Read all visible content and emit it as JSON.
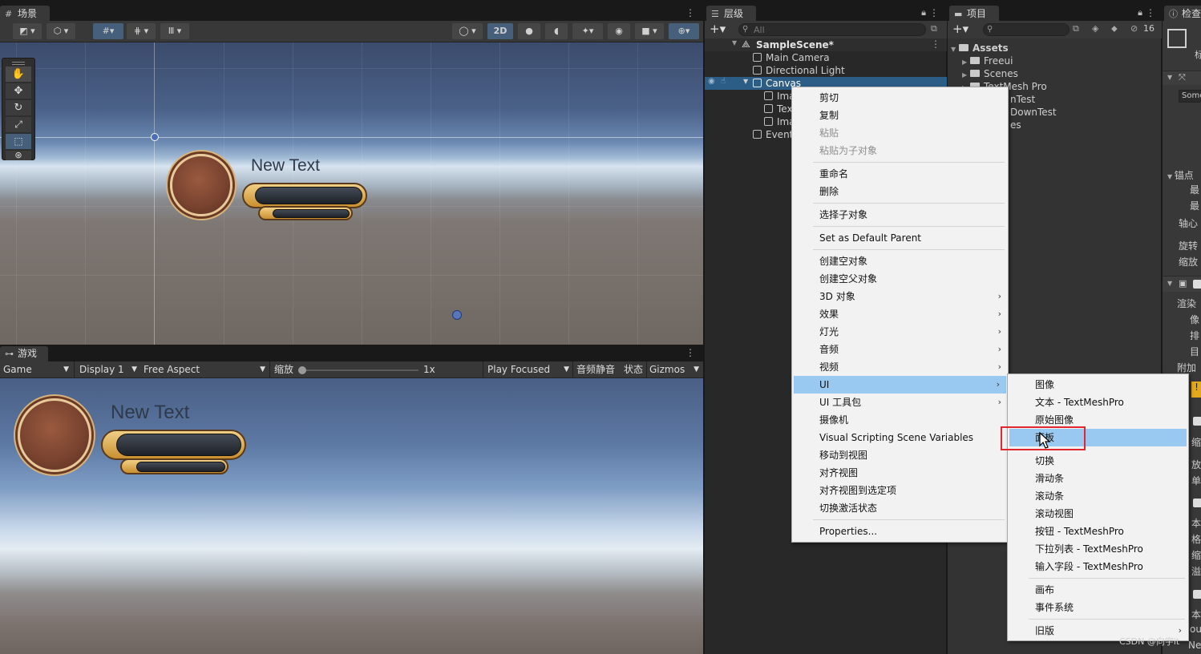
{
  "scene_panel": {
    "tab": "场景",
    "toolbar_2d": "2D",
    "canvas_text": "New Text"
  },
  "game_panel": {
    "tab": "游戏",
    "game_dropdown": "Game",
    "display_dropdown": "Display 1",
    "aspect_dropdown": "Free Aspect",
    "scale_label": "缩放",
    "scale_value": "1x",
    "play_focused": "Play Focused",
    "mute_audio": "音频静音",
    "stats": "状态",
    "gizmos": "Gizmos",
    "canvas_text": "New Text"
  },
  "hierarchy": {
    "tab": "层级",
    "search_placeholder": "All",
    "scene_name": "SampleScene*",
    "items": [
      "Main Camera",
      "Directional Light",
      "Canvas",
      "Ima",
      "Tex",
      "Ima",
      "Event"
    ]
  },
  "project": {
    "tab": "项目",
    "hidden_count": "16",
    "root": "Assets",
    "items": [
      "Freeui",
      "Scenes",
      "TextMesh Pro",
      "nTest",
      "DownTest",
      "es"
    ]
  },
  "inspector": {
    "tab": "检查",
    "labels": [
      "标",
      "Some",
      "锚点",
      "最",
      "最",
      "轴心",
      "旋转",
      "缩放",
      "渲染",
      "像",
      "排",
      "目",
      "附加",
      "缩",
      "放",
      "单",
      "本",
      "格",
      "缩",
      "溢",
      "本",
      "out",
      "New"
    ]
  },
  "context_menu": {
    "items": [
      {
        "label": "剪切",
        "enabled": true
      },
      {
        "label": "复制",
        "enabled": true
      },
      {
        "label": "粘贴",
        "enabled": false
      },
      {
        "label": "粘贴为子对象",
        "enabled": false
      },
      {
        "label": "重命名",
        "enabled": true
      },
      {
        "label": "删除",
        "enabled": true
      },
      {
        "label": "选择子对象",
        "enabled": true
      },
      {
        "label": "Set as Default Parent",
        "enabled": true
      },
      {
        "label": "创建空对象",
        "enabled": true
      },
      {
        "label": "创建空父对象",
        "enabled": true
      },
      {
        "label": "3D 对象",
        "enabled": true,
        "submenu": true
      },
      {
        "label": "效果",
        "enabled": true,
        "submenu": true
      },
      {
        "label": "灯光",
        "enabled": true,
        "submenu": true
      },
      {
        "label": "音频",
        "enabled": true,
        "submenu": true
      },
      {
        "label": "视频",
        "enabled": true,
        "submenu": true
      },
      {
        "label": "UI",
        "enabled": true,
        "submenu": true,
        "highlighted": true
      },
      {
        "label": "UI 工具包",
        "enabled": true,
        "submenu": true
      },
      {
        "label": "摄像机",
        "enabled": true
      },
      {
        "label": "Visual Scripting Scene Variables",
        "enabled": true
      },
      {
        "label": "移动到视图",
        "enabled": true
      },
      {
        "label": "对齐视图",
        "enabled": true
      },
      {
        "label": "对齐视图到选定项",
        "enabled": true
      },
      {
        "label": "切换激活状态",
        "enabled": true
      },
      {
        "label": "Properties...",
        "enabled": true
      }
    ]
  },
  "ui_submenu": {
    "items": [
      {
        "label": "图像"
      },
      {
        "label": "文本 - TextMeshPro"
      },
      {
        "label": "原始图像"
      },
      {
        "label": "面板",
        "highlighted": true
      },
      {
        "label": "切换"
      },
      {
        "label": "滑动条"
      },
      {
        "label": "滚动条"
      },
      {
        "label": "滚动视图"
      },
      {
        "label": "按钮 - TextMeshPro"
      },
      {
        "label": "下拉列表 - TextMeshPro"
      },
      {
        "label": "输入字段 - TextMeshPro"
      },
      {
        "label": "画布"
      },
      {
        "label": "事件系统"
      },
      {
        "label": "旧版",
        "submenu": true
      }
    ]
  },
  "watermark": "CSDN @向宇it",
  "colors": {
    "menu_highlight": "#99c9f0",
    "selection": "#2c5d87",
    "callout_border": "#e0282e"
  }
}
